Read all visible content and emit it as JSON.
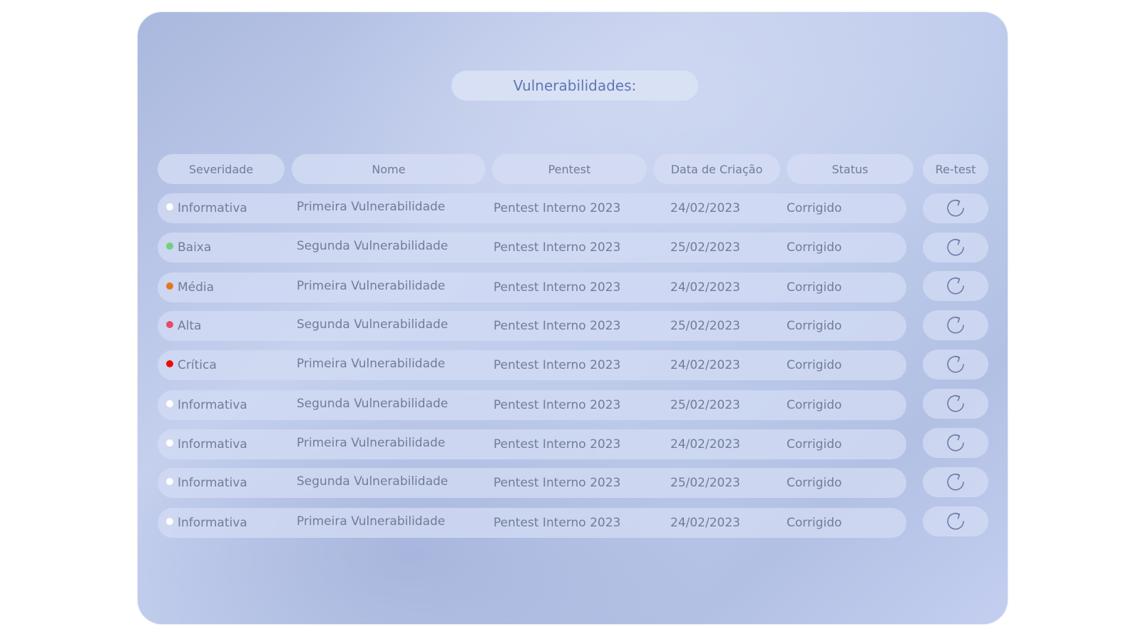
{
  "title": "Vulnerabilidades:",
  "columns": [
    "Severidade",
    "Nome",
    "Pentest",
    "Data de Criação",
    "Status",
    "Re-test"
  ],
  "severity_colors": {
    "Informativa": "#ffffff",
    "Baixa": "#6fd17a",
    "Média": "#e5761e",
    "Alta": "#e84a6a",
    "Crítica": "#ef0a0a"
  },
  "icon_color": "#6e7aa8",
  "rows": [
    {
      "severity": "Informativa",
      "nome": "Primeira Vulnerabilidade",
      "pentest": "Pentest Interno 2023",
      "data": "24/02/2023",
      "status": "Corrigido",
      "retest_icon": "refresh-icon"
    },
    {
      "severity": "Baixa",
      "nome": "Segunda Vulnerabilidade",
      "pentest": "Pentest Interno 2023",
      "data": "25/02/2023",
      "status": "Corrigido",
      "retest_icon": "refresh-icon"
    },
    {
      "severity": "Média",
      "nome": "Primeira Vulnerabilidade",
      "pentest": "Pentest Interno 2023",
      "data": "24/02/2023",
      "status": "Corrigido",
      "retest_icon": "refresh-icon"
    },
    {
      "severity": "Alta",
      "nome": "Segunda Vulnerabilidade",
      "pentest": "Pentest Interno 2023",
      "data": "25/02/2023",
      "status": "Corrigido",
      "retest_icon": "refresh-icon"
    },
    {
      "severity": "Crítica",
      "nome": "Primeira Vulnerabilidade",
      "pentest": "Pentest Interno 2023",
      "data": "24/02/2023",
      "status": "Corrigido",
      "retest_icon": "refresh-icon"
    },
    {
      "severity": "Informativa",
      "nome": "Segunda Vulnerabilidade",
      "pentest": "Pentest Interno 2023",
      "data": "25/02/2023",
      "status": "Corrigido",
      "retest_icon": "refresh-icon"
    },
    {
      "severity": "Informativa",
      "nome": "Primeira Vulnerabilidade",
      "pentest": "Pentest Interno 2023",
      "data": "24/02/2023",
      "status": "Corrigido",
      "retest_icon": "refresh-icon"
    },
    {
      "severity": "Informativa",
      "nome": "Segunda Vulnerabilidade",
      "pentest": "Pentest Interno 2023",
      "data": "25/02/2023",
      "status": "Corrigido",
      "retest_icon": "refresh-icon"
    },
    {
      "severity": "Informativa",
      "nome": "Primeira Vulnerabilidade",
      "pentest": "Pentest Interno 2023",
      "data": "24/02/2023",
      "status": "Corrigido",
      "retest_icon": "refresh-icon"
    }
  ]
}
